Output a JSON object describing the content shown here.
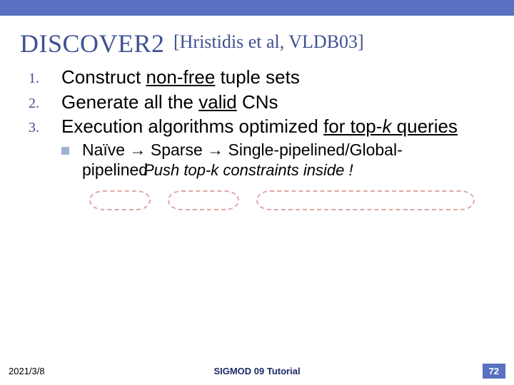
{
  "title": {
    "main": "DISCOVER2",
    "cite": "[Hristidis et al, VLDB03]"
  },
  "items": [
    {
      "num": "1.",
      "pre": "Construct ",
      "ul": "non-free",
      "post": " tuple sets"
    },
    {
      "num": "2.",
      "pre": "Generate all the ",
      "ul": "valid",
      "post": " CNs"
    },
    {
      "num": "3.",
      "pre": "Execution algorithms optimized ",
      "ul": "for top-",
      "ital": "k",
      "post2_ul": " queries"
    }
  ],
  "sub": {
    "line1": "Naïve → Sparse → Single-pipelined/Global-",
    "line2_a": "pipelined",
    "line2_b": "Push top-k constraints inside !"
  },
  "footer": {
    "date": "2021/3/8",
    "center": "SIGMOD 09 Tutorial",
    "page": "72"
  }
}
